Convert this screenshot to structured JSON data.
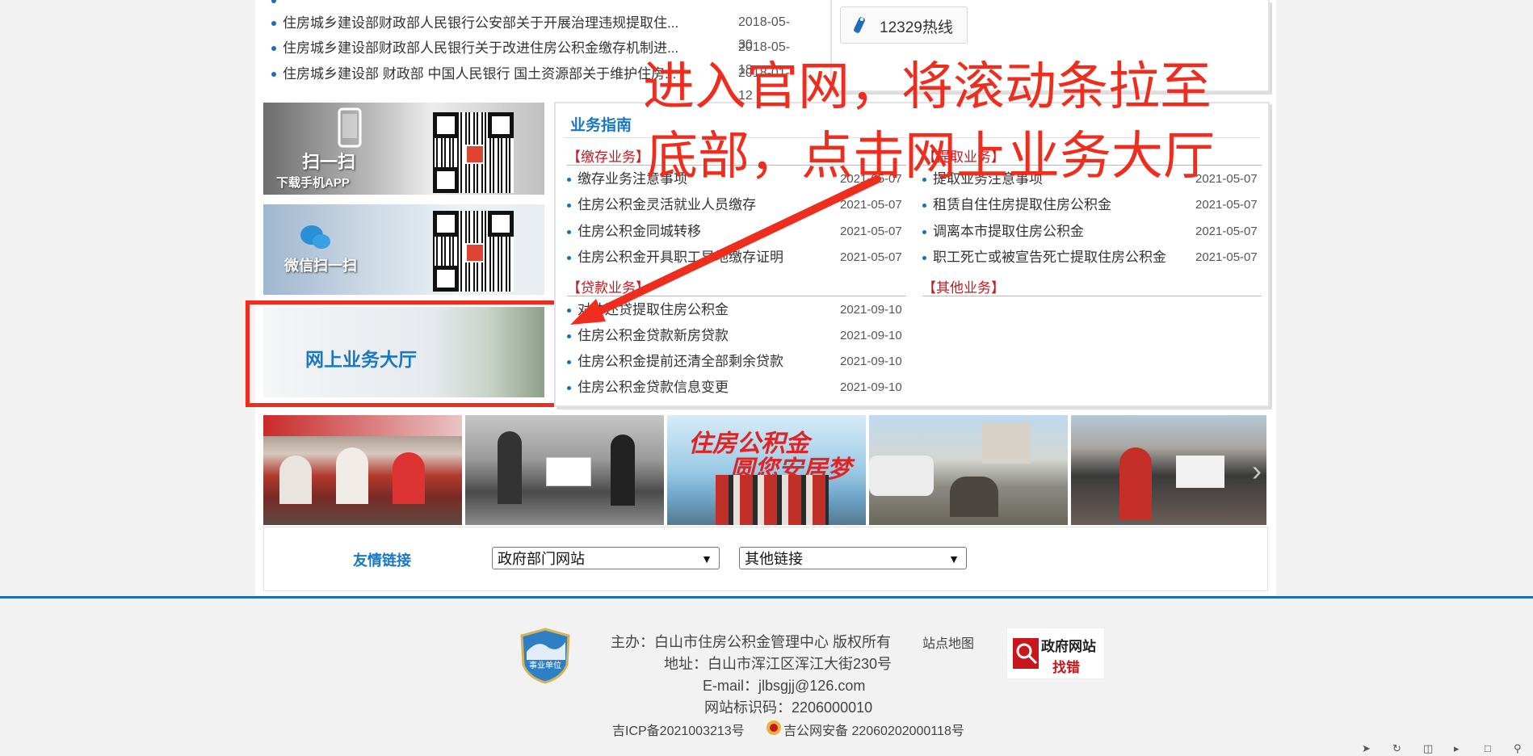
{
  "news": {
    "items": [
      {
        "title": "住房城乡建设部财政部人民银行公安部关于开展治理违规提取住...",
        "date": "2018-05-30"
      },
      {
        "title": "住房城乡建设部财政部人民银行关于改进住房公积金缴存机制进...",
        "date": "2018-05-18"
      },
      {
        "title": "住房城乡建设部 财政部 中国人民银行 国土资源部关于维护住房...",
        "date": "2018-01-12"
      }
    ]
  },
  "hotline": {
    "label": "12329热线"
  },
  "banners": {
    "app_label": "扫一扫",
    "app_sublabel": "下载手机APP",
    "wechat_label": "微信扫一扫",
    "online_hall_label": "网上业务大厅"
  },
  "guide": {
    "title": "业务指南",
    "deposit": {
      "category": "【缴存业务】",
      "items": [
        {
          "title": "缴存业务注意事项",
          "date": "2021-05-07"
        },
        {
          "title": "住房公积金灵活就业人员缴存",
          "date": "2021-05-07"
        },
        {
          "title": "住房公积金同城转移",
          "date": "2021-05-07"
        },
        {
          "title": "住房公积金开具职工异地缴存证明",
          "date": "2021-05-07"
        }
      ]
    },
    "withdraw": {
      "category": "【提取业务】",
      "items": [
        {
          "title": "提取业务注意事项",
          "date": "2021-05-07"
        },
        {
          "title": "租赁自住住房提取住房公积金",
          "date": "2021-05-07"
        },
        {
          "title": "调离本市提取住房公积金",
          "date": "2021-05-07"
        },
        {
          "title": "职工死亡或被宣告死亡提取住房公积金",
          "date": "2021-05-07"
        }
      ]
    },
    "loan": {
      "category": "【贷款业务】",
      "items": [
        {
          "title": "对冲还贷提取住房公积金",
          "date": "2021-09-10"
        },
        {
          "title": "住房公积金贷款新房贷款",
          "date": "2021-09-10"
        },
        {
          "title": "住房公积金提前还清全部剩余贷款",
          "date": "2021-09-10"
        },
        {
          "title": "住房公积金贷款信息变更",
          "date": "2021-09-10"
        }
      ]
    },
    "other": {
      "category": "【其他业务】"
    }
  },
  "photos": {
    "banner_text_1": "住房公积金",
    "banner_text_2": "圆您安居梦"
  },
  "links": {
    "label": "友情链接",
    "gov_select": "政府部门网站",
    "other_select": "其他链接"
  },
  "footer": {
    "badge_text": "事业单位",
    "sponsor": "主办：白山市住房公积金管理中心  版权所有",
    "sitemap": "站点地图",
    "address": "地址：白山市浑江区浑江大街230号",
    "email": "E-mail：jlbsgjj@126.com",
    "site_id": "网站标识码：2206000010",
    "icp": "吉ICP备2021003213号",
    "police": "吉公网安备 22060202000118号",
    "gov_error_line1": "政府网站",
    "gov_error_line2": "找错"
  },
  "annotation": {
    "line1": "进入官网，将滚动条拉至",
    "line2": "底部，点击网上业务大厅"
  },
  "colors": {
    "accent": "#1a78c2",
    "category_red": "#c8161d",
    "annotation_red": "#ee2d1e"
  }
}
